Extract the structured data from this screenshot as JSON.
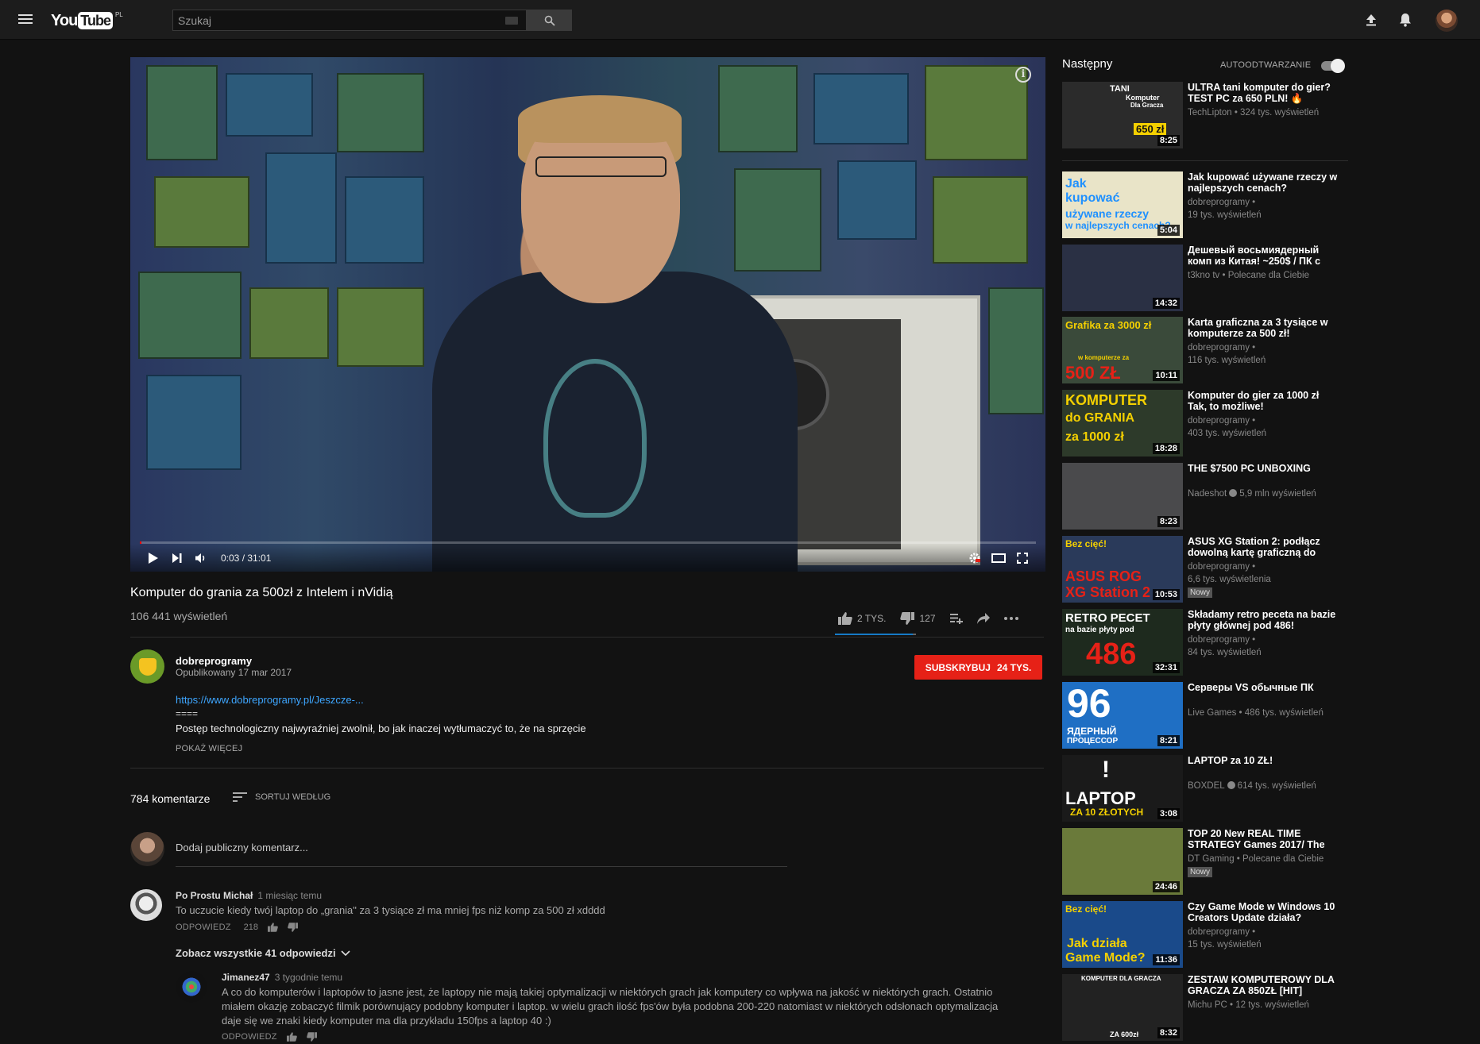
{
  "header": {
    "logo_you": "You",
    "logo_tube": "Tube",
    "logo_country": "PL",
    "search_placeholder": "Szukaj"
  },
  "player": {
    "time": "0:03 / 31:01",
    "progress_fraction": 0.002
  },
  "video": {
    "title": "Komputer do grania za 500zł z Intelem i nVidią",
    "views": "106 441 wyświetleń",
    "likes": "2 TYS.",
    "dislikes": "127"
  },
  "channel": {
    "name": "dobreprogramy",
    "published": "Opublikowany 17 mar 2017",
    "subscribe_label": "SUBSKRYBUJ",
    "subscriber_count": "24 TYS."
  },
  "description": {
    "link": "https://www.dobreprogramy.pl/Jeszcze-...",
    "separator": "====",
    "text": "Postęp technologiczny najwyraźniej zwolnił, bo jak inaczej wytłumaczyć to, że na sprzęcie",
    "show_more": "POKAŻ WIĘCEJ"
  },
  "comments": {
    "count": "784 komentarze",
    "sort_label": "SORTUJ WEDŁUG",
    "add_placeholder": "Dodaj publiczny komentarz...",
    "reply_label": "ODPOWIEDZ",
    "items": [
      {
        "author": "Po Prostu Michał",
        "time": "1 miesiąc temu",
        "text": "To uczucie kiedy twój laptop do „grania\" za 3 tysiące zł ma mniej fps niż komp za 500 zł xdddd",
        "likes": "218"
      }
    ],
    "see_replies": "Zobacz wszystkie 41 odpowiedzi",
    "replies": [
      {
        "author": "Jimanez47",
        "time": "3 tygodnie temu",
        "text_lines": [
          "A co do komputerów i laptopów to jasne jest, że laptopy nie mają takiej optymalizacji w niektórych grach jak komputery co wpływa na jakość w niektórych grach. Ostatnio",
          "miałem okazję zobaczyć filmik porównujący podobny komputer i laptop. w wielu grach ilość fps'ów była podobna 200-220 natomiast w niektórych odsłonach optymalizacja",
          "daje się we znaki kiedy komputer ma dla przykładu 150fps a laptop 40 :)"
        ]
      }
    ]
  },
  "sidebar": {
    "next_label": "Następny",
    "autoplay_label": "AUTOODTWARZANIE",
    "autoplay_on": true,
    "items": [
      {
        "title": "ULTRA tani komputer do gier? TEST PC za 650 PLN! 🔥",
        "meta1": "TechLipton • 324 tys. wyświetleń",
        "meta2": "",
        "badge": "",
        "duration": "8:25",
        "thumb_text": [
          "TANI",
          "Komputer",
          "Dla Gracza",
          "650 zł"
        ],
        "thumb_bg": "#2b2b2b"
      },
      {
        "title": "Jak kupować używane rzeczy w najlepszych cenach?",
        "meta1": "dobreprogramy •",
        "meta2": "19 tys. wyświetleń",
        "badge": "",
        "duration": "5:04",
        "thumb_text": [
          "Jak",
          "kupować",
          "używane rzeczy",
          "w najlepszych cenach?"
        ],
        "thumb_bg": "#e9e4c8"
      },
      {
        "title": "Дешевый восьмиядерный комп из Китая! ~250$ / ПК с",
        "meta1": "t3kno tv • Polecane dla Ciebie",
        "meta2": "",
        "badge": "",
        "duration": "14:32",
        "thumb_text": [],
        "thumb_bg": "#2a3044"
      },
      {
        "title": "Karta graficzna za 3 tysiące w komputerze za 500 zł!",
        "meta1": "dobreprogramy •",
        "meta2": "116 tys. wyświetleń",
        "badge": "",
        "duration": "10:11",
        "thumb_text": [
          "Grafika za 3000 zł",
          "w komputerze za",
          "500 ZŁ"
        ],
        "thumb_bg": "#3a4a3a"
      },
      {
        "title": "Komputer do gier za 1000 zł Tak, to możliwe!",
        "meta1": "dobreprogramy •",
        "meta2": "403 tys. wyświetleń",
        "badge": "",
        "duration": "18:28",
        "thumb_text": [
          "KOMPUTER",
          "do GRANIA",
          "za 1000 zł"
        ],
        "thumb_bg": "#2d3a2a"
      },
      {
        "title": "THE $7500 PC UNBOXING",
        "meta1": "Nadeshot",
        "meta1_verified": true,
        "meta1_rest": "5,9 mln wyświetleń",
        "meta2": "",
        "badge": "",
        "duration": "8:23",
        "thumb_text": [],
        "thumb_bg": "#4a4a4c"
      },
      {
        "title": "ASUS XG Station 2: podłącz dowolną kartę graficzną do",
        "meta1": "dobreprogramy •",
        "meta2": "6,6 tys. wyświetlenia",
        "badge": "Nowy",
        "duration": "10:53",
        "thumb_text": [
          "Bez cięć!",
          "ASUS ROG",
          "XG Station 2"
        ],
        "thumb_bg": "#2a3a5a"
      },
      {
        "title": "Składamy retro peceta na bazie płyty głównej pod 486!",
        "meta1": "dobreprogramy •",
        "meta2": "84 tys. wyświetleń",
        "badge": "",
        "duration": "32:31",
        "thumb_text": [
          "RETRO PECET",
          "na bazie płyty pod",
          "486"
        ],
        "thumb_bg": "#1e2a1e"
      },
      {
        "title": "Серверы VS обычные ПК",
        "meta1": "Live Games • 486 tys. wyświetleń",
        "meta2": "",
        "badge": "",
        "duration": "8:21",
        "thumb_text": [
          "96",
          "ЯДЕРНЫЙ",
          "ПРОЦЕССОР"
        ],
        "thumb_bg": "#1f6fc4"
      },
      {
        "title": "LAPTOP za 10 ZŁ!",
        "meta1": "BOXDEL",
        "meta1_verified": true,
        "meta1_rest": "614 tys. wyświetleń",
        "meta2": "",
        "badge": "",
        "duration": "3:08",
        "thumb_text": [
          "!",
          "LAPTOP",
          "ZA 10 ZŁOTYCH"
        ],
        "thumb_bg": "#1a1a1a"
      },
      {
        "title": "TOP 20 New REAL TIME STRATEGY Games 2017/ The",
        "meta1": "DT Gaming • Polecane dla Ciebie",
        "meta2": "",
        "badge": "Nowy",
        "duration": "24:46",
        "thumb_text": [],
        "thumb_bg": "#6a7a3a"
      },
      {
        "title": "Czy Game Mode w Windows 10 Creators Update działa?",
        "meta1": "dobreprogramy •",
        "meta2": "15 tys. wyświetleń",
        "badge": "",
        "duration": "11:36",
        "thumb_text": [
          "Bez cięć!",
          "Jak działa",
          "Game Mode?"
        ],
        "thumb_bg": "#1a4a8a"
      },
      {
        "title": "ZESTAW KOMPUTEROWY DLA GRACZA ZA 850ZŁ [HIT]",
        "meta1": "Michu PC • 12 tys. wyświetleń",
        "meta2": "",
        "badge": "",
        "duration": "8:32",
        "thumb_text": [
          "KOMPUTER DLA GRACZA",
          "ZA 600zł"
        ],
        "thumb_bg": "#222"
      }
    ]
  },
  "colors": {
    "accent_red": "#e62117",
    "like_blue": "#167ac6",
    "link_blue": "#3ea6ff"
  }
}
